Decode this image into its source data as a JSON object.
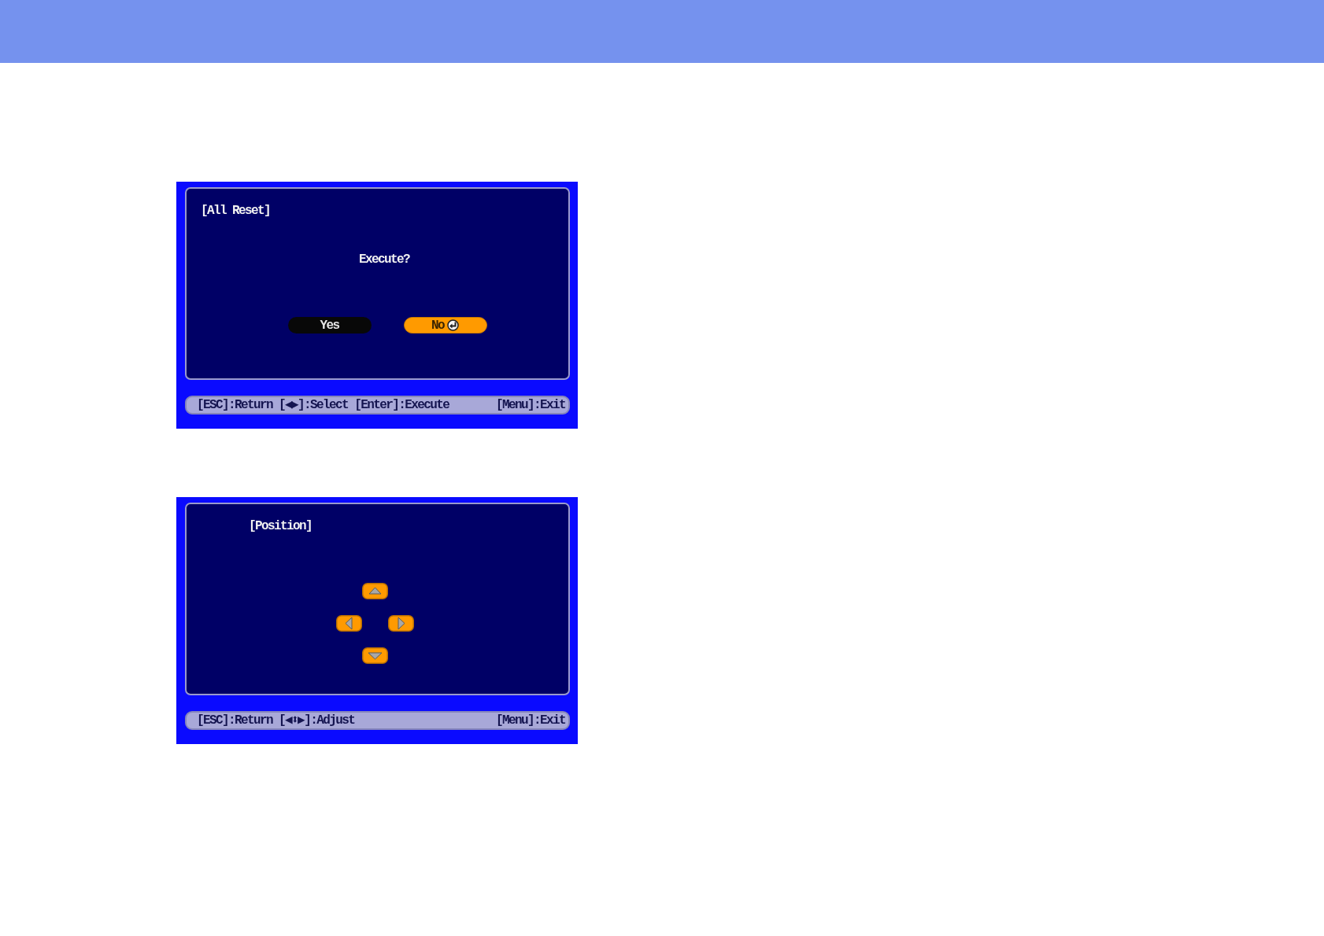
{
  "dialogs": [
    {
      "kind": "confirm",
      "title": "[All Reset]",
      "message": "Execute?",
      "buttons": [
        {
          "label": "Yes",
          "selected": false,
          "enter_mark": false
        },
        {
          "label": "No",
          "selected": true,
          "enter_mark": true
        }
      ],
      "footer": {
        "hints": [
          "[ESC]:Return",
          "[◀▶]:Select",
          "[Enter]:Execute"
        ],
        "exit": "[Menu]:Exit"
      }
    },
    {
      "kind": "position",
      "title": "[Position]",
      "footer": {
        "hints": [
          "[ESC]:Return",
          "[◀⬍▶]:Adjust"
        ],
        "exit": "[Menu]:Exit"
      }
    }
  ]
}
